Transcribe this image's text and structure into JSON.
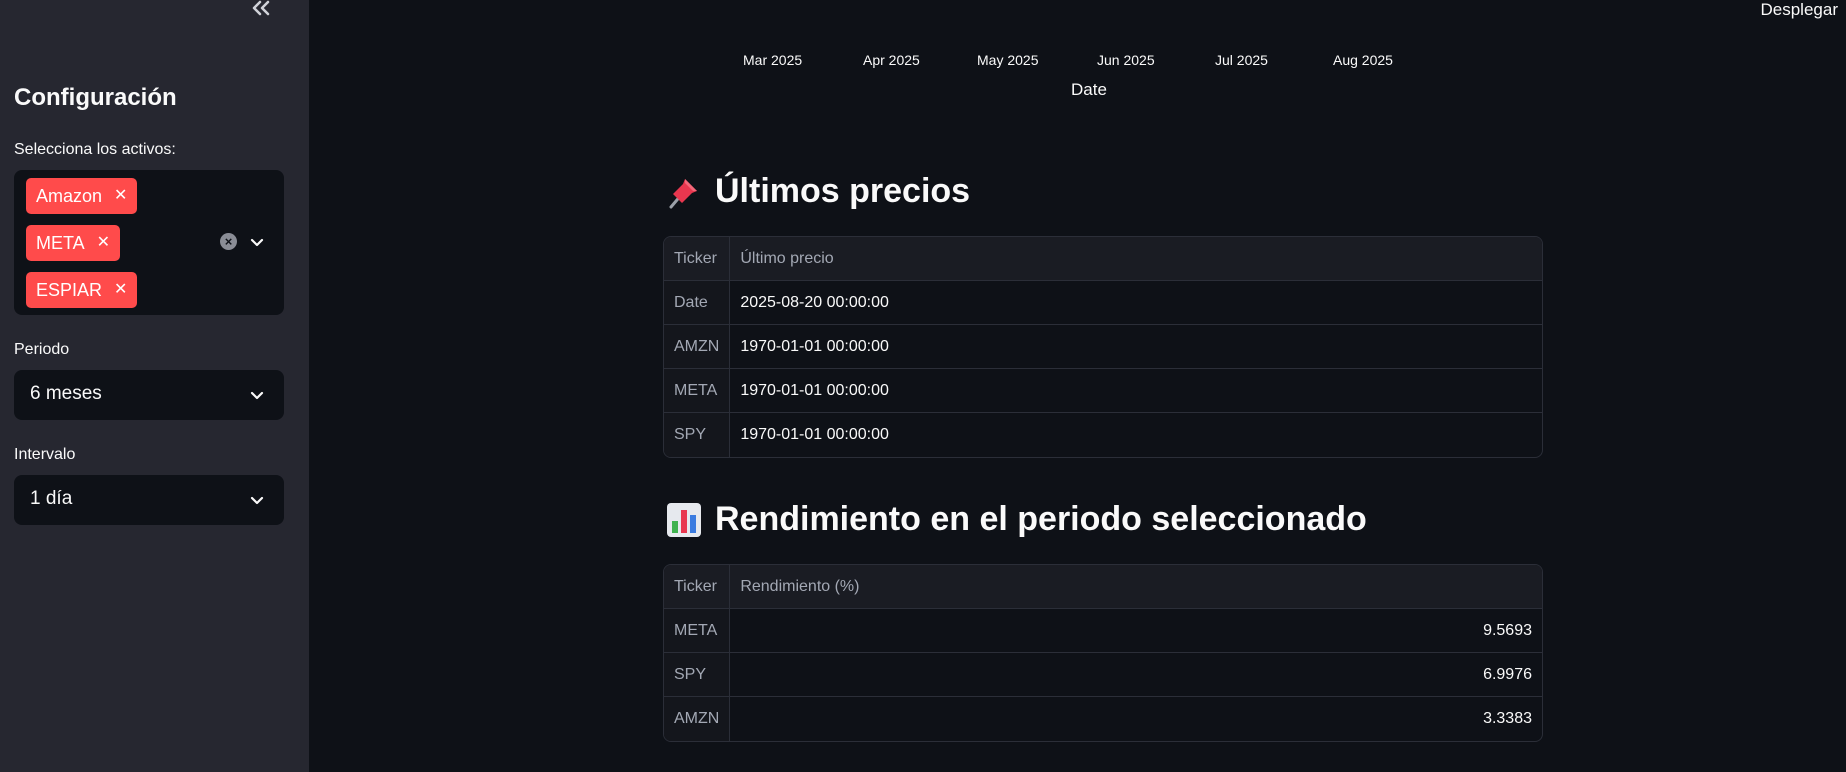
{
  "sidebar": {
    "collapse_icon": "double-chevron-left-icon",
    "title": "Configuración",
    "assets_label": "Selecciona los activos:",
    "selected_assets": [
      "Amazon",
      "META",
      "ESPIAR"
    ],
    "period_label": "Periodo",
    "period_value": "6 meses",
    "interval_label": "Intervalo",
    "interval_value": "1 día"
  },
  "header": {
    "deploy_label": "Desplegar"
  },
  "chart_axis": {
    "ticks": [
      "Mar 2025",
      "Apr 2025",
      "May 2025",
      "Jun 2025",
      "Jul 2025",
      "Aug 2025"
    ],
    "title": "Date"
  },
  "latest_prices": {
    "emoji": "pushpin-icon",
    "title": "Últimos precios",
    "columns": [
      "Ticker",
      "Último precio"
    ],
    "rows": [
      {
        "ticker": "Date",
        "value": "2025-08-20 00:00:00"
      },
      {
        "ticker": "AMZN",
        "value": "1970-01-01 00:00:00"
      },
      {
        "ticker": "META",
        "value": "1970-01-01 00:00:00"
      },
      {
        "ticker": "SPY",
        "value": "1970-01-01 00:00:00"
      }
    ]
  },
  "returns": {
    "emoji": "bar-chart-icon",
    "title": "Rendimiento en el periodo seleccionado",
    "columns": [
      "Ticker",
      "Rendimiento (%)"
    ],
    "rows": [
      {
        "ticker": "META",
        "value": "9.5693"
      },
      {
        "ticker": "SPY",
        "value": "6.9976"
      },
      {
        "ticker": "AMZN",
        "value": "3.3383"
      }
    ]
  },
  "colors": {
    "accent": "#ff4b4b",
    "background": "#0e1117",
    "sidebar": "#262730"
  }
}
